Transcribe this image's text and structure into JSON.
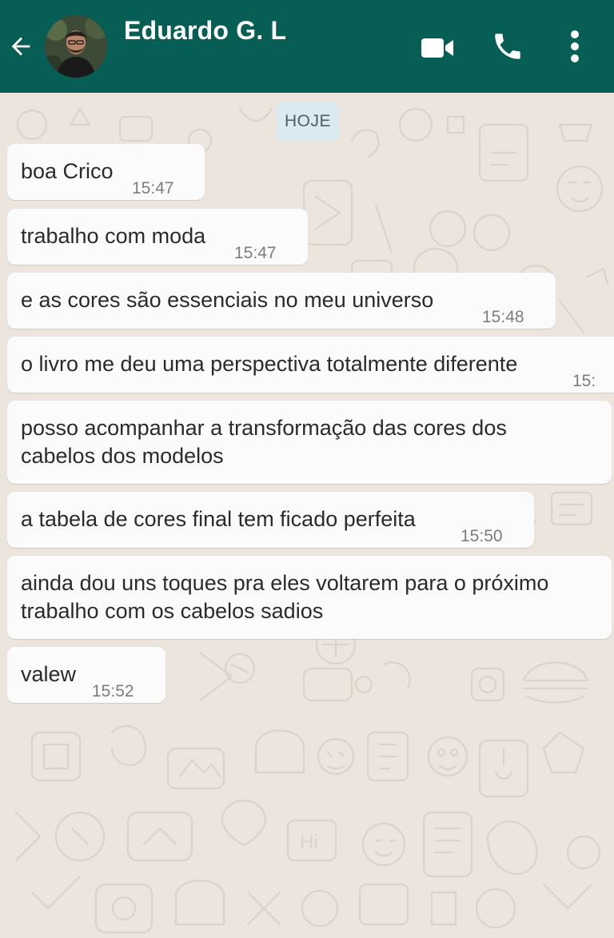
{
  "header": {
    "contact_name": "Eduardo G. L",
    "icons": {
      "back": "arrow-left-icon",
      "video": "videocam-icon",
      "call": "phone-icon",
      "menu": "more-vert-icon"
    },
    "color": "#075e54"
  },
  "chat": {
    "date_label": "HOJE",
    "messages": [
      {
        "text": "boa Crico",
        "time": "15:47"
      },
      {
        "text": "trabalho com moda",
        "time": "15:47"
      },
      {
        "text": "e as cores são essenciais no meu universo",
        "time": "15:48"
      },
      {
        "text": "o livro me deu uma perspectiva totalmente diferente",
        "time": "15:"
      },
      {
        "line1": "posso acompanhar a transformação das cores dos",
        "line2": "cabelos dos modelos"
      },
      {
        "text": "a tabela de cores final tem ficado perfeita",
        "time": "15:50"
      },
      {
        "line1": "ainda dou uns toques pra eles voltarem para o próximo",
        "line2": "trabalho com os cabelos sadios"
      },
      {
        "text": "valew",
        "time": "15:52"
      }
    ],
    "bubble_color": "#fbfbfb",
    "background_color": "#ece5dd"
  }
}
